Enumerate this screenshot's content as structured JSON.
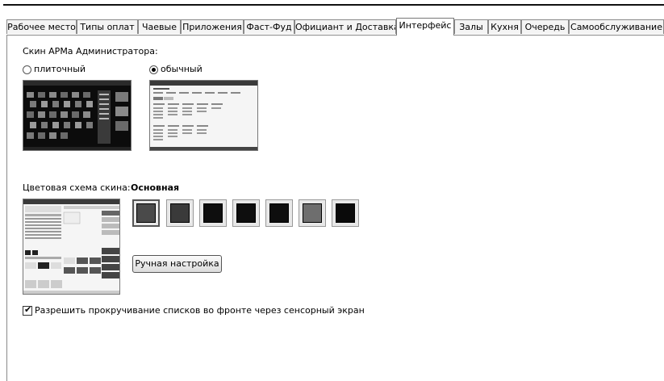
{
  "tabs": [
    {
      "label": "Рабочее место"
    },
    {
      "label": "Типы оплат"
    },
    {
      "label": "Чаевые"
    },
    {
      "label": "Приложения"
    },
    {
      "label": "Фаст-Фуд"
    },
    {
      "label": "Официант и Доставка"
    },
    {
      "label": "Интерфейс",
      "active": true
    },
    {
      "label": "Залы"
    },
    {
      "label": "Кухня"
    },
    {
      "label": "Очередь"
    },
    {
      "label": "Самообслуживание"
    }
  ],
  "interface": {
    "skin_label": "Скин АРМа Администратора:",
    "skin_options": [
      {
        "label": "плиточный",
        "selected": false
      },
      {
        "label": "обычный",
        "selected": true
      }
    ],
    "color_scheme_label": "Цветовая схема скина:",
    "color_scheme_value": "Основная",
    "swatches": [
      {
        "color": "#4a4a4a",
        "selected": true
      },
      {
        "color": "#3a3a3a",
        "selected": false
      },
      {
        "color": "#0e0e0e",
        "selected": false
      },
      {
        "color": "#0e0e0e",
        "selected": false
      },
      {
        "color": "#0e0e0e",
        "selected": false
      },
      {
        "color": "#6e6e6e",
        "selected": false
      },
      {
        "color": "#0a0a0a",
        "selected": false
      }
    ],
    "manual_button": "Ручная настройка",
    "scroll_checkbox_label": "Разрешить прокручивание списков во фронте через сенсорный экран",
    "scroll_checkbox_checked": true
  }
}
